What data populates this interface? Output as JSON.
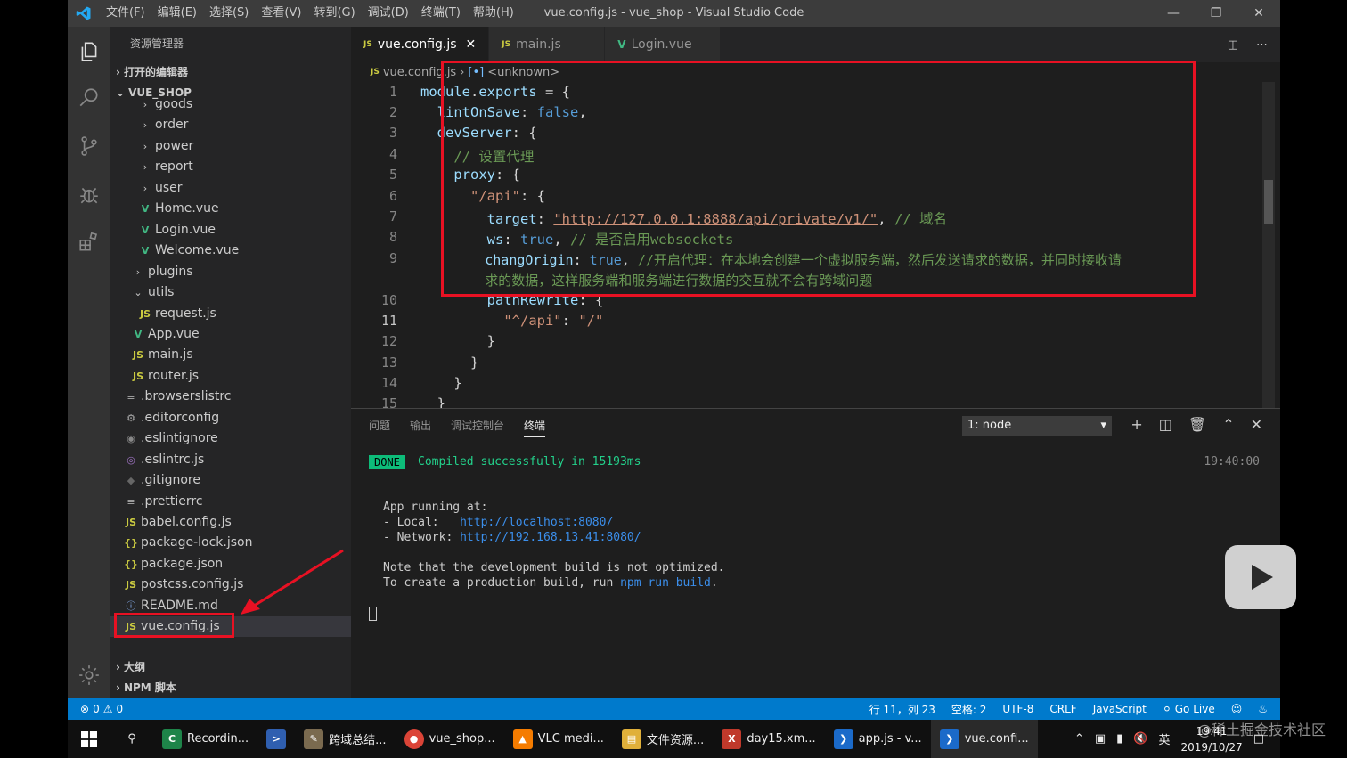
{
  "window": {
    "title": "vue.config.js - vue_shop - Visual Studio Code",
    "menus": [
      "文件(F)",
      "编辑(E)",
      "选择(S)",
      "查看(V)",
      "转到(G)",
      "调试(D)",
      "终端(T)",
      "帮助(H)"
    ]
  },
  "sidebar": {
    "header": "资源管理器",
    "open_editors": "打开的编辑器",
    "project": "VUE_SHOP",
    "tree": [
      {
        "label": "goods",
        "type": "folder",
        "indent": 2
      },
      {
        "label": "order",
        "type": "folder",
        "indent": 2
      },
      {
        "label": "power",
        "type": "folder",
        "indent": 2
      },
      {
        "label": "report",
        "type": "folder",
        "indent": 2
      },
      {
        "label": "user",
        "type": "folder",
        "indent": 2
      },
      {
        "label": "Home.vue",
        "type": "vue",
        "indent": 2
      },
      {
        "label": "Login.vue",
        "type": "vue",
        "indent": 2
      },
      {
        "label": "Welcome.vue",
        "type": "vue",
        "indent": 2
      },
      {
        "label": "plugins",
        "type": "folder",
        "indent": 1
      },
      {
        "label": "utils",
        "type": "folder-open",
        "indent": 1
      },
      {
        "label": "request.js",
        "type": "js",
        "indent": 2
      },
      {
        "label": "App.vue",
        "type": "vue",
        "indent": 1
      },
      {
        "label": "main.js",
        "type": "js",
        "indent": 1
      },
      {
        "label": "router.js",
        "type": "js",
        "indent": 1
      },
      {
        "label": ".browserslistrc",
        "type": "lines",
        "indent": 0
      },
      {
        "label": ".editorconfig",
        "type": "gear",
        "indent": 0
      },
      {
        "label": ".eslintignore",
        "type": "circle",
        "indent": 0
      },
      {
        "label": ".eslintrc.js",
        "type": "eslint",
        "indent": 0
      },
      {
        "label": ".gitignore",
        "type": "git",
        "indent": 0
      },
      {
        "label": ".prettierrc",
        "type": "lines",
        "indent": 0
      },
      {
        "label": "babel.config.js",
        "type": "js",
        "indent": 0
      },
      {
        "label": "package-lock.json",
        "type": "json",
        "indent": 0
      },
      {
        "label": "package.json",
        "type": "json",
        "indent": 0
      },
      {
        "label": "postcss.config.js",
        "type": "js",
        "indent": 0
      },
      {
        "label": "README.md",
        "type": "info",
        "indent": 0
      },
      {
        "label": "vue.config.js",
        "type": "js",
        "indent": 0,
        "selected": true
      }
    ],
    "outline": "大纲",
    "npm": "NPM 脚本"
  },
  "tabs": [
    {
      "label": "vue.config.js",
      "icon": "JS",
      "active": true
    },
    {
      "label": "main.js",
      "icon": "JS",
      "active": false
    },
    {
      "label": "Login.vue",
      "icon": "V",
      "active": false
    }
  ],
  "breadcrumb": {
    "file": "vue.config.js",
    "symbol": "<unknown>"
  },
  "code": {
    "line_numbers": [
      "1",
      "2",
      "3",
      "4",
      "5",
      "6",
      "7",
      "8",
      "9",
      "",
      "10",
      "11",
      "12",
      "13",
      "14",
      "15"
    ],
    "l1a": "module",
    "l1b": ".",
    "l1c": "exports",
    "l1d": " = {",
    "l2a": "  lintOnSave",
    "l2b": ": ",
    "l2c": "false",
    "l2d": ",",
    "l3a": "  devServer",
    "l3b": ": {",
    "l4": "    // 设置代理",
    "l5a": "    proxy",
    "l5b": ": {",
    "l6a": "      \"/api\"",
    "l6b": ": {",
    "l7a": "        target",
    "l7b": ": ",
    "l7c": "\"http://127.0.0.1:8888/api/private/v1/\"",
    "l7d": ", ",
    "l7e": "// 域名",
    "l8a": "        ws",
    "l8b": ": ",
    "l8c": "true",
    "l8d": ", ",
    "l8e": "// 是否启用websockets",
    "l9a": "        changOrigin",
    "l9b": ": ",
    "l9c": "true",
    "l9d": ", ",
    "l9e": "//开启代理：在本地会创建一个虚拟服务端，然后发送请求的数据，并同时接收请",
    "l9w": "        求的数据，这样服务端和服务端进行数据的交互就不会有跨域问题",
    "l10a": "        pathRewrite",
    "l10b": ": {",
    "l11a": "          \"^/api\"",
    "l11b": ": ",
    "l11c": "\"/\"",
    "l12": "        }",
    "l13": "      }",
    "l14": "    }",
    "l15": "  }"
  },
  "panel": {
    "tabs": [
      "问题",
      "输出",
      "调试控制台",
      "终端"
    ],
    "active_tab": "终端",
    "terminal_select": "1: node",
    "done_badge": "DONE",
    "compiled": "Compiled successfully in 15193ms",
    "time": "19:40:00",
    "running": "App running at:",
    "local_label": "- Local:   ",
    "local_url": "http://localhost:8080/",
    "network_label": "- Network: ",
    "network_url": "http://192.168.13.41:8080/",
    "note1": "Note that the development build is not optimized.",
    "note2a": "To create a production build, run ",
    "note2b": "npm run build",
    "note2c": "."
  },
  "status": {
    "errors": "0",
    "warnings": "0",
    "position": "行 11，列 23",
    "spaces": "空格: 2",
    "encoding": "UTF-8",
    "eol": "CRLF",
    "language": "JavaScript",
    "golive": "Go Live"
  },
  "taskbar": {
    "apps": [
      "Recordin...",
      "",
      "跨域总结...",
      "vue_shop...",
      "VLC medi...",
      "文件资源...",
      "day15.xm...",
      "app.js - v...",
      "vue.confi..."
    ],
    "ime": "英",
    "time": "19:41",
    "date": "2019/10/27"
  },
  "watermark": "@稀土掘金技术社区",
  "colors": {
    "accent": "#007acc",
    "highlight": "#e81123"
  }
}
